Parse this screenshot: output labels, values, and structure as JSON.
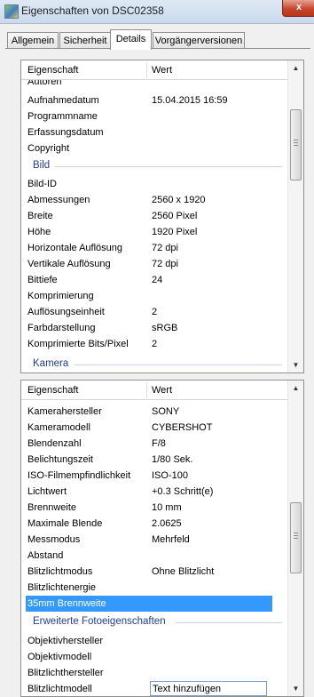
{
  "window": {
    "title": "Eigenschaften von DSC02358",
    "close_glyph": "x"
  },
  "tabs": [
    {
      "label": "Allgemein",
      "active": false
    },
    {
      "label": "Sicherheit",
      "active": false
    },
    {
      "label": "Details",
      "active": true
    },
    {
      "label": "Vorgängerversionen",
      "active": false
    }
  ],
  "columns": {
    "property": "Eigenschaft",
    "value": "Wert"
  },
  "panel_top": {
    "rows": [
      {
        "name": "Autoren",
        "value": ""
      },
      {
        "name": "Aufnahmedatum",
        "value": "15.04.2015 16:59"
      },
      {
        "name": "Programmname",
        "value": ""
      },
      {
        "name": "Erfassungsdatum",
        "value": ""
      },
      {
        "name": "Copyright",
        "value": ""
      }
    ],
    "group_bild": "Bild",
    "rows_bild": [
      {
        "name": "Bild-ID",
        "value": ""
      },
      {
        "name": "Abmessungen",
        "value": "2560 x 1920"
      },
      {
        "name": "Breite",
        "value": "2560 Pixel"
      },
      {
        "name": "Höhe",
        "value": "1920 Pixel"
      },
      {
        "name": "Horizontale Auflösung",
        "value": "72 dpi"
      },
      {
        "name": "Vertikale Auflösung",
        "value": "72 dpi"
      },
      {
        "name": "Bittiefe",
        "value": "24"
      },
      {
        "name": "Komprimierung",
        "value": ""
      },
      {
        "name": "Auflösungseinheit",
        "value": "2"
      },
      {
        "name": "Farbdarstellung",
        "value": "sRGB"
      },
      {
        "name": "Komprimierte Bits/Pixel",
        "value": "2"
      }
    ],
    "group_kamera": "Kamera"
  },
  "panel_bottom": {
    "rows": [
      {
        "name": "Kamerahersteller",
        "value": "SONY"
      },
      {
        "name": "Kameramodell",
        "value": "CYBERSHOT"
      },
      {
        "name": "Blendenzahl",
        "value": "F/8"
      },
      {
        "name": "Belichtungszeit",
        "value": "1/80 Sek."
      },
      {
        "name": "ISO-Filmempfindlichkeit",
        "value": "ISO-100"
      },
      {
        "name": "Lichtwert",
        "value": "+0.3 Schritt(e)"
      },
      {
        "name": "Brennweite",
        "value": "10 mm"
      },
      {
        "name": "Maximale Blende",
        "value": "2.0625"
      },
      {
        "name": "Messmodus",
        "value": "Mehrfeld"
      },
      {
        "name": "Abstand",
        "value": ""
      },
      {
        "name": "Blitzlichtmodus",
        "value": "Ohne Blitzlicht"
      },
      {
        "name": "Blitzlichtenergie",
        "value": ""
      },
      {
        "name": "35mm Brennweite",
        "value": ""
      }
    ],
    "group_foto": "Erweiterte Fotoeigenschaften",
    "rows_foto": [
      {
        "name": "Objektivhersteller",
        "value": ""
      },
      {
        "name": "Objektivmodell",
        "value": ""
      },
      {
        "name": "Blitzlichthersteller",
        "value": ""
      },
      {
        "name": "Blitzlichtmodell",
        "value": ""
      }
    ],
    "edit_placeholder": "Text hinzufügen"
  },
  "icons": {
    "scroll_up": "triangle-up-icon",
    "scroll_down": "triangle-down-icon"
  },
  "colors": {
    "selection": "#3399ff",
    "group_text": "#1e3c9c"
  }
}
